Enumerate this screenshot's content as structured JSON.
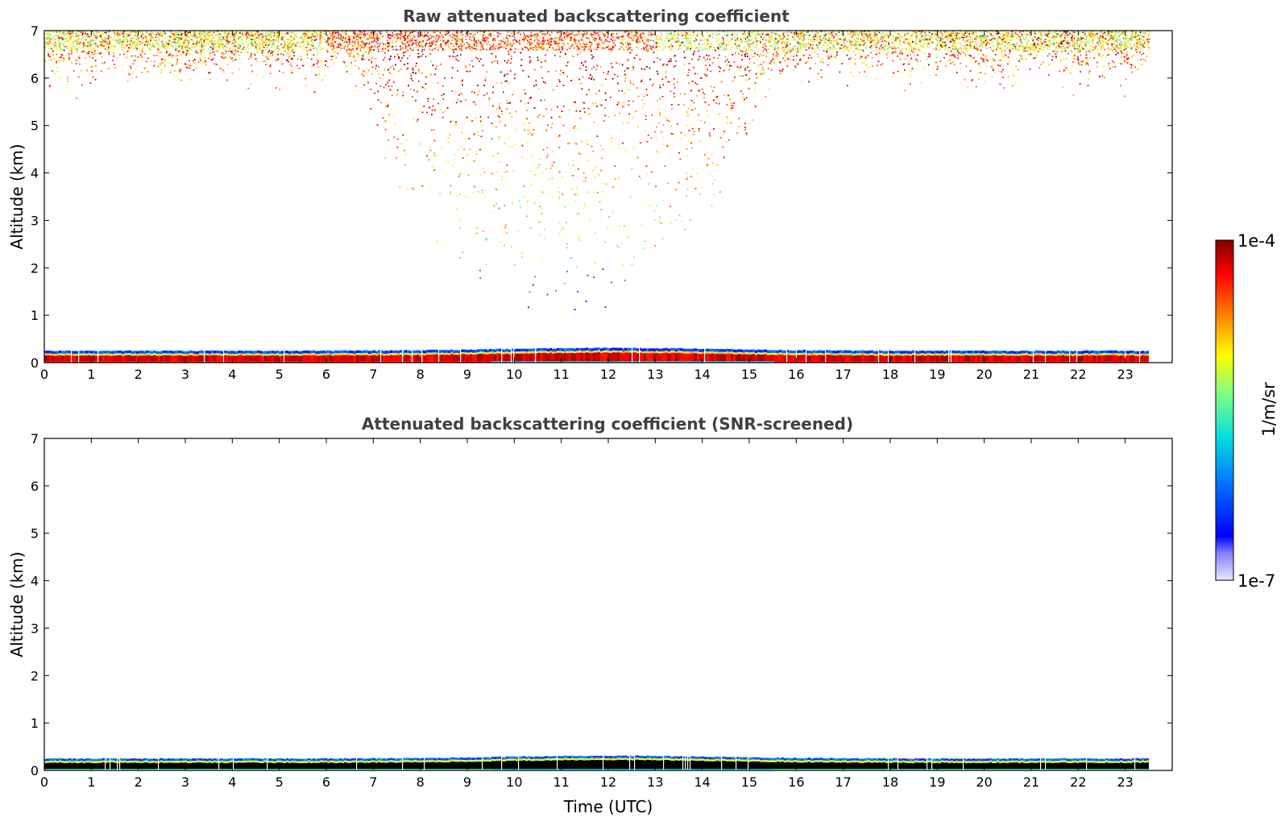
{
  "chart_data": [
    {
      "type": "heatmap",
      "title": "Raw attenuated backscattering coefficient",
      "xlabel": "",
      "ylabel": "Altitude (km)",
      "xlim": [
        0,
        24
      ],
      "ylim": [
        0,
        7
      ],
      "xticks": [
        0,
        1,
        2,
        3,
        4,
        5,
        6,
        7,
        8,
        9,
        10,
        11,
        12,
        13,
        14,
        15,
        16,
        17,
        18,
        19,
        20,
        21,
        22,
        23
      ],
      "yticks": [
        0,
        1,
        2,
        3,
        4,
        5,
        6,
        7
      ],
      "data_end_time": 23.5,
      "layers": [
        {
          "name": "boundary layer band",
          "altitude_km": [
            0,
            0.25
          ],
          "value_range": "1e-5 to 1e-4"
        },
        {
          "name": "upper noise",
          "altitude_km": [
            5,
            7
          ],
          "value_range": "1e-6 to 1e-4"
        },
        {
          "name": "noise funnel",
          "time_utc": [
            6,
            16
          ],
          "altitude_km": [
            0.5,
            7
          ]
        }
      ]
    },
    {
      "type": "heatmap",
      "title": "Attenuated backscattering coefficient (SNR-screened)",
      "xlabel": "Time (UTC)",
      "ylabel": "Altitude (km)",
      "xlim": [
        0,
        24
      ],
      "ylim": [
        0,
        7
      ],
      "xticks": [
        0,
        1,
        2,
        3,
        4,
        5,
        6,
        7,
        8,
        9,
        10,
        11,
        12,
        13,
        14,
        15,
        16,
        17,
        18,
        19,
        20,
        21,
        22,
        23
      ],
      "yticks": [
        0,
        1,
        2,
        3,
        4,
        5,
        6,
        7
      ],
      "data_end_time": 23.5,
      "layers": [
        {
          "name": "boundary layer band",
          "altitude_km": [
            0,
            0.3
          ]
        }
      ]
    }
  ],
  "colorbar": {
    "max_label": "1e-4",
    "min_label": "1e-7",
    "unit_label": "1/m/sr",
    "scale": "log",
    "colormap": "jet"
  }
}
